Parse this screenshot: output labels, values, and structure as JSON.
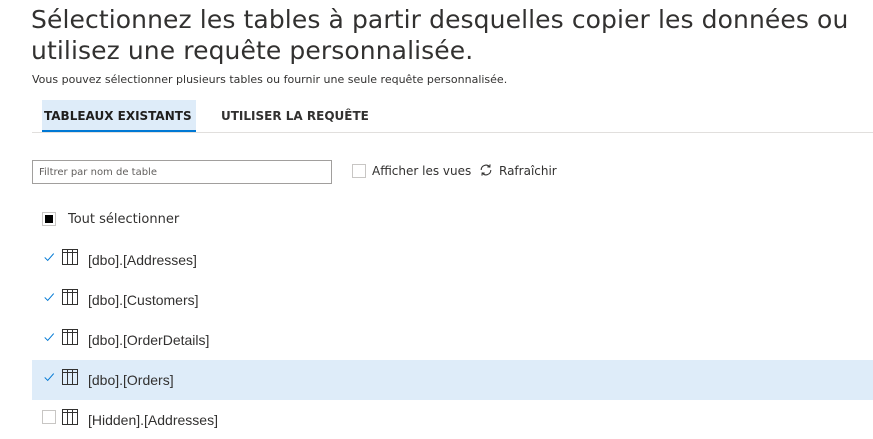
{
  "header": {
    "title": "Sélectionnez les tables à partir desquelles copier les données ou utilisez une requête personnalisée.",
    "subtitle": "Vous pouvez sélectionner plusieurs tables ou fournir une seule requête personnalisée."
  },
  "tabs": [
    {
      "label": "TABLEAUX EXISTANTS",
      "active": true
    },
    {
      "label": "UTILISER LA REQUÊTE",
      "active": false
    }
  ],
  "filter": {
    "placeholder": "Filtrer par nom de table",
    "value": ""
  },
  "views_toggle": {
    "label": "Afficher les vues",
    "checked": false
  },
  "refresh": {
    "label": "Rafraîchir",
    "icon": "refresh-icon"
  },
  "select_all": {
    "label": "Tout sélectionner",
    "state": "indeterminate"
  },
  "tables": [
    {
      "label": "[dbo].[Addresses]",
      "checked": true,
      "selected": false
    },
    {
      "label": "[dbo].[Customers]",
      "checked": true,
      "selected": false
    },
    {
      "label": "[dbo].[OrderDetails]",
      "checked": true,
      "selected": false
    },
    {
      "label": "[dbo].[Orders]",
      "checked": true,
      "selected": true
    },
    {
      "label": "[Hidden].[Addresses]",
      "checked": false,
      "selected": false
    }
  ],
  "colors": {
    "accent": "#0078d4",
    "selected_row": "#deecf9",
    "text": "#323130"
  }
}
